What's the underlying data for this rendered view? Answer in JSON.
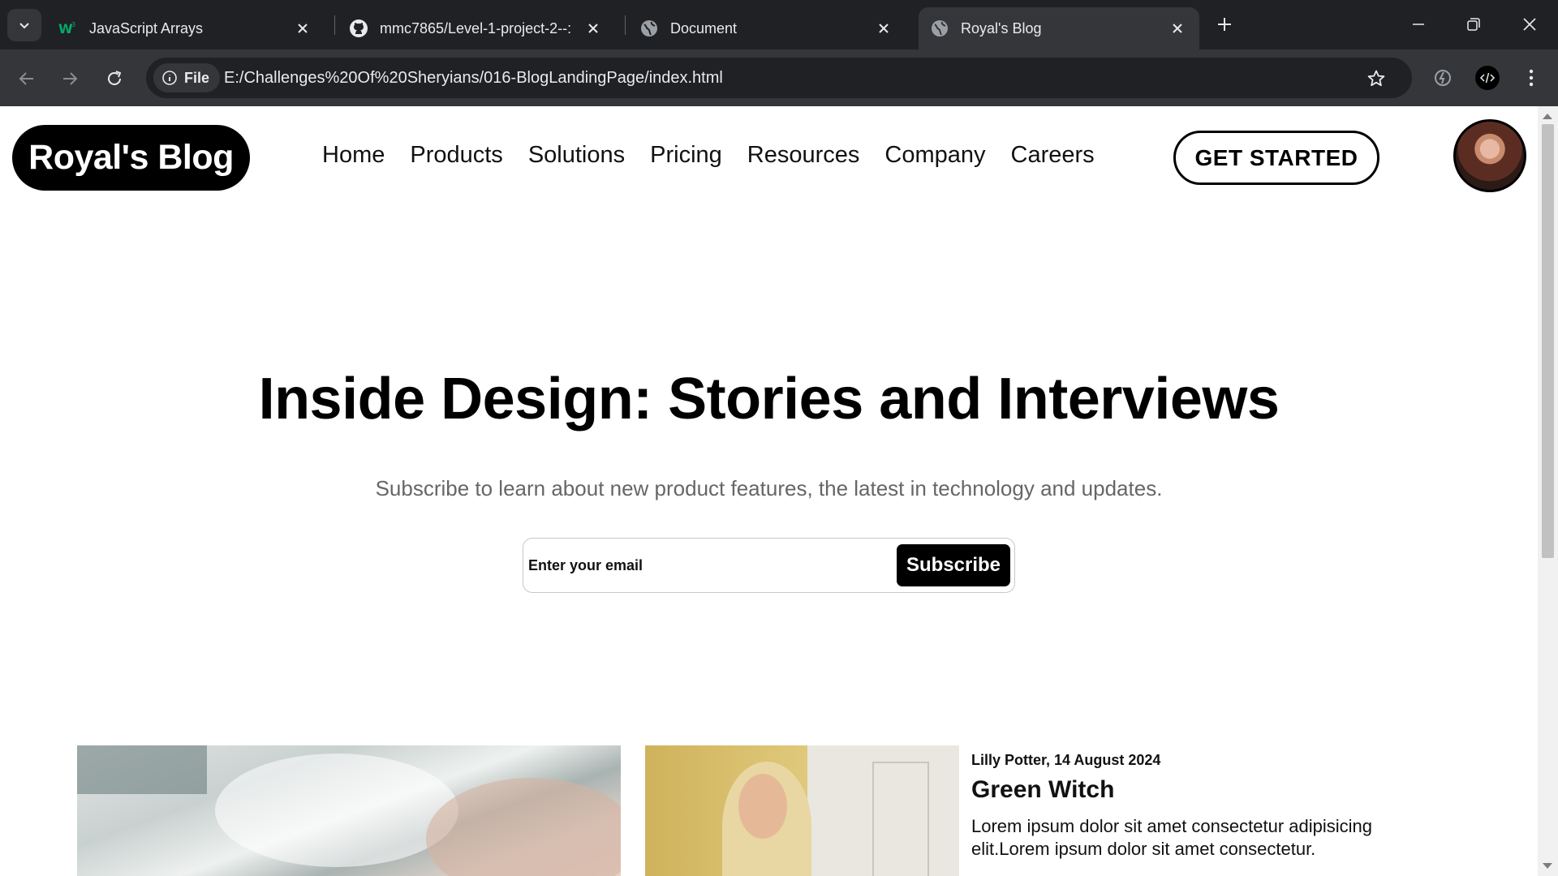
{
  "browser": {
    "tabs": [
      {
        "title": "JavaScript Arrays",
        "icon": "w3schools-icon",
        "active": false
      },
      {
        "title": "mmc7865/Level-1-project-2--:",
        "icon": "github-icon",
        "active": false
      },
      {
        "title": "Document",
        "icon": "globe-icon",
        "active": false
      },
      {
        "title": "Royal's Blog",
        "icon": "globe-icon",
        "active": true
      }
    ],
    "address_chip": "File",
    "url": "E:/Challenges%20Of%20Sheryians/016-BlogLandingPage/index.html"
  },
  "site": {
    "logo": "Royal's Blog",
    "nav": [
      "Home",
      "Products",
      "Solutions",
      "Pricing",
      "Resources",
      "Company",
      "Careers"
    ],
    "cta": "GET STARTED"
  },
  "hero": {
    "title": "Inside Design: Stories and Interviews",
    "subtitle": "Subscribe to learn about new product features, the latest in technology and updates.",
    "email_placeholder": "Enter your email",
    "subscribe_label": "Subscribe"
  },
  "featured_post": {
    "meta": "Lilly Potter, 14 August 2024",
    "title": "Green Witch",
    "excerpt": "Lorem ipsum dolor sit amet consectetur adipisicing elit.Lorem ipsum dolor sit amet consectetur."
  },
  "colors": {
    "chrome_bg": "#202124",
    "toolbar_bg": "#35363a",
    "brand": "#000000",
    "muted_text": "#666666"
  }
}
